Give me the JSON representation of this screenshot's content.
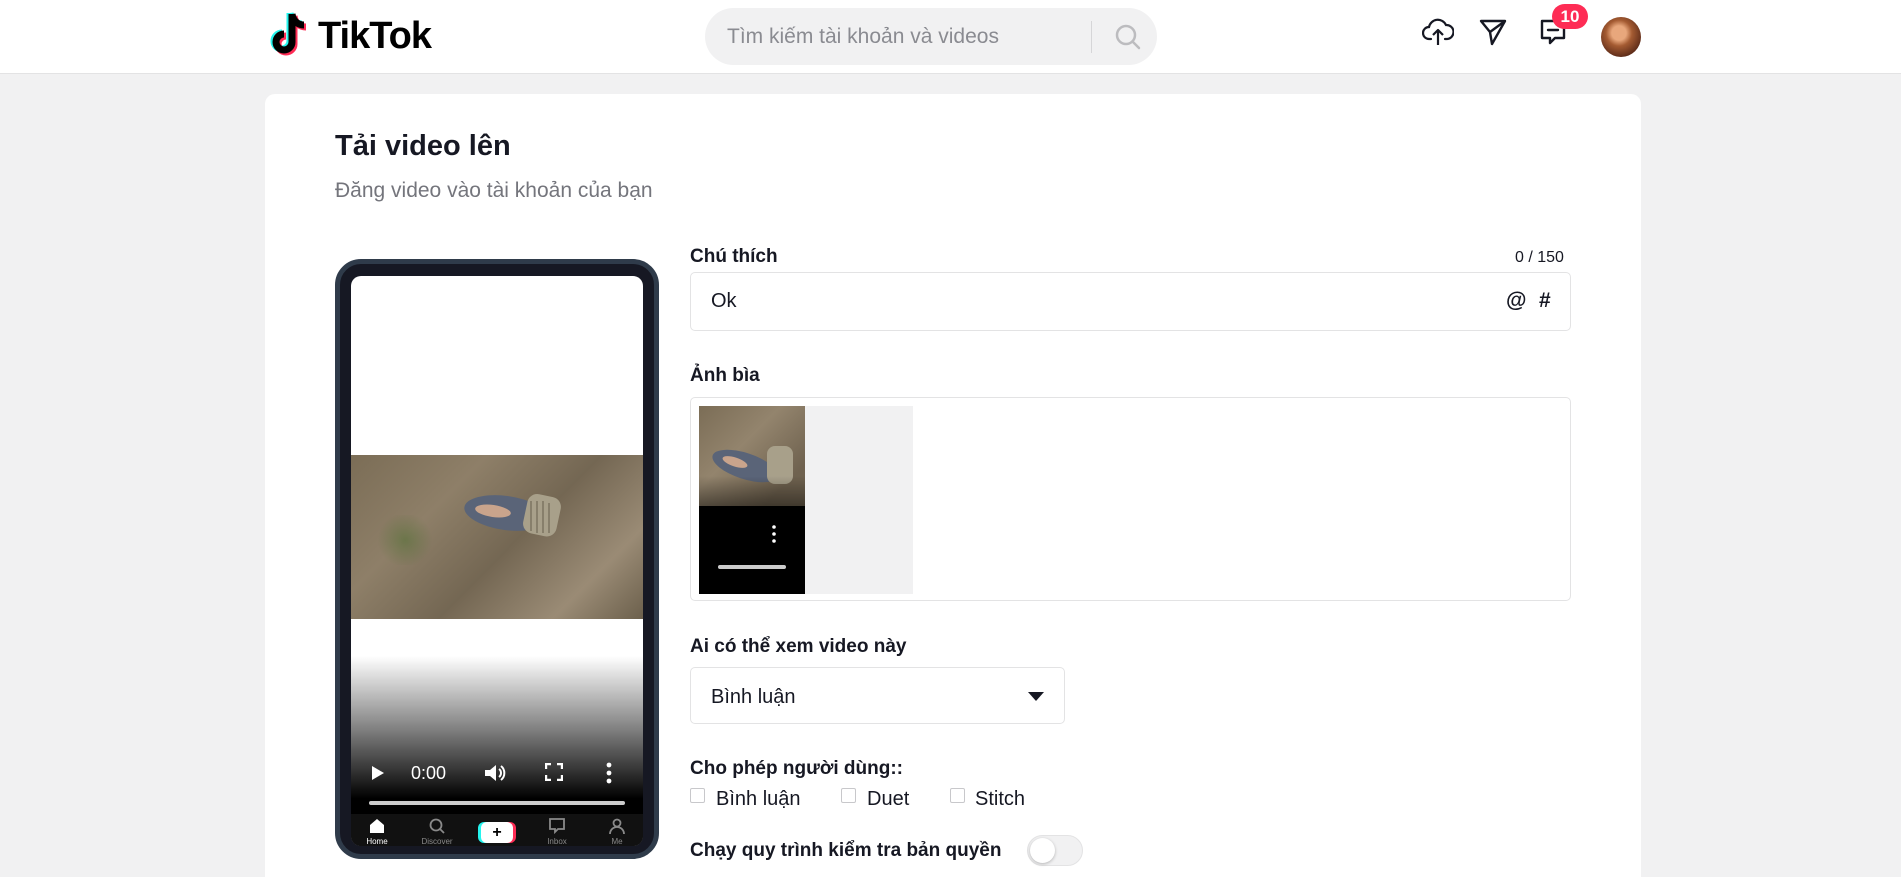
{
  "header": {
    "brand": "TikTok",
    "search_placeholder": "Tìm kiếm tài khoản và videos",
    "notification_count": "10",
    "icons": [
      "tiktok-logo-icon",
      "search-icon",
      "upload-cloud-icon",
      "send-icon",
      "inbox-icon",
      "avatar"
    ]
  },
  "page": {
    "title": "Tải video lên",
    "subtitle": "Đăng video vào tài khoản của bạn"
  },
  "preview": {
    "time": "0:00",
    "nav": [
      "Home",
      "Discover",
      "+",
      "Inbox",
      "Me"
    ]
  },
  "form": {
    "caption_label": "Chú thích",
    "caption_counter": "0 / 150",
    "caption_value": "Ok",
    "mention_symbol": "@",
    "hashtag_symbol": "#",
    "cover_label": "Ảnh bìa",
    "privacy_label": "Ai có thể xem video này",
    "privacy_value": "Bình luận",
    "allow_label": "Cho phép người dùng::",
    "allow_options": [
      "Bình luận",
      "Duet",
      "Stitch"
    ],
    "copyright_label": "Chạy quy trình kiểm tra bản quyền",
    "copyright_enabled": false
  },
  "colors": {
    "brand_red": "#fe2c55",
    "brand_cyan": "#25f4ee",
    "text": "#161823",
    "muted": "#74757c"
  }
}
